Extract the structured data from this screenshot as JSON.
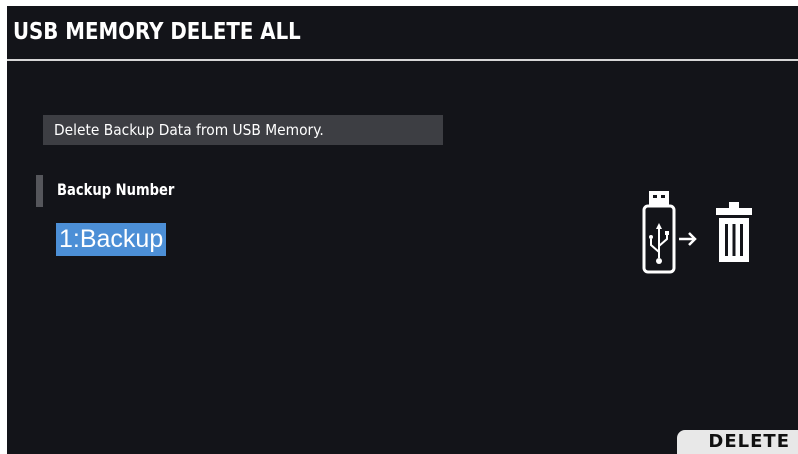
{
  "screen": {
    "title": "USB MEMORY DELETE ALL"
  },
  "message": {
    "text": "Delete Backup Data from USB Memory."
  },
  "parameter": {
    "label": "Backup Number",
    "value": "1:Backup"
  },
  "illustration": {
    "icons": [
      "usb-memory-icon",
      "right-arrow-icon",
      "trash-can-icon"
    ]
  },
  "function_buttons": {
    "delete_label": "DELETE"
  },
  "colors": {
    "background": "#131419",
    "title_text": "#ffffff",
    "message_box": "#3d3e43",
    "selection_highlight": "#4c8fd6",
    "soft_button": "#e8e8e8"
  }
}
